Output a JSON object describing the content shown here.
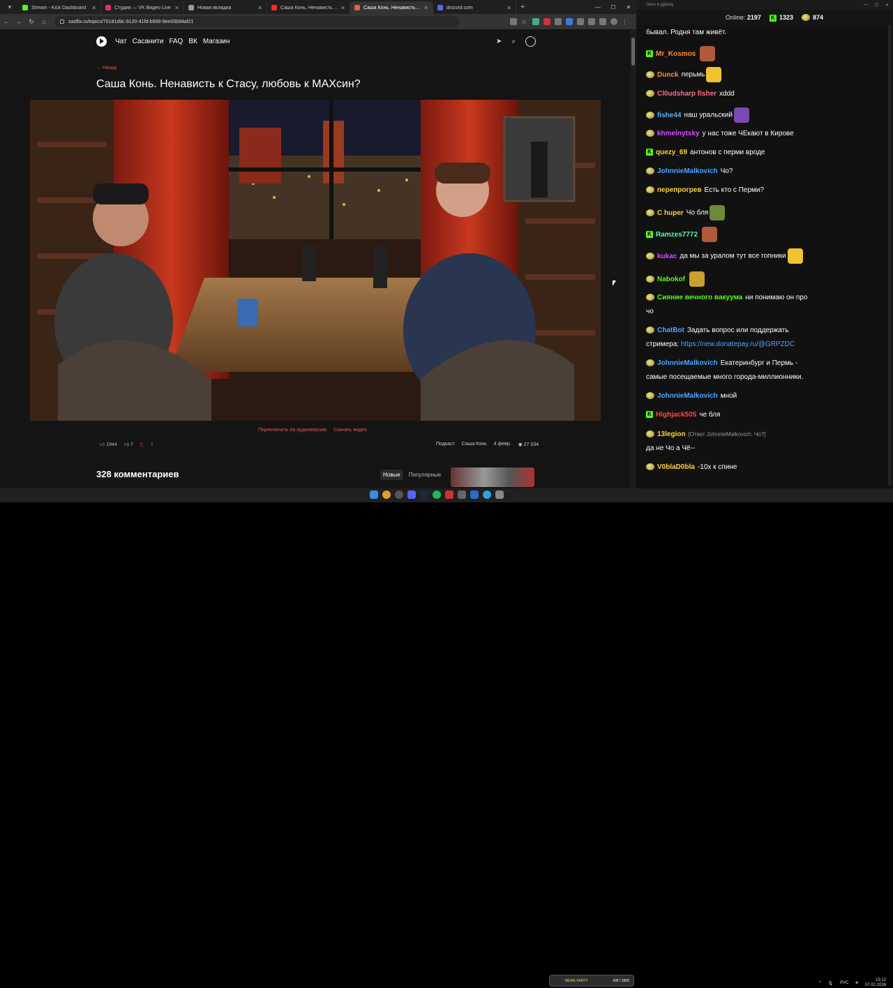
{
  "browser": {
    "tabs": [
      {
        "label": "Stream - Kick Dashboard",
        "color": "#53fc18"
      },
      {
        "label": "Студия — VK Видео Live",
        "color": "#e0306a"
      },
      {
        "label": "Новая вкладка",
        "color": "#999999"
      },
      {
        "label": "Саша Конь. Ненависть к Стасу",
        "color": "#ff2a2a"
      },
      {
        "label": "Саша Конь. Ненависть к С...",
        "color": "#e0604a",
        "active": true
      },
      {
        "label": "discord.com",
        "color": "#5865f2"
      }
    ],
    "url": "sasflix.ru/topics/75181d9c-9120-41fd-b999-9ee00b94af21"
  },
  "site": {
    "nav": [
      "Чат",
      "Сасанити",
      "FAQ",
      "ВК",
      "Магазин"
    ],
    "back": "← Назад",
    "title": "Саша Конь. Ненависть к Стасу, любовь к МАХсин?",
    "audio_link": "Переключить на аудиоверсию",
    "download_link": "Скачать видео",
    "likes": "1944",
    "dislikes": "7",
    "category": "Подкаст",
    "author": "Саша Конь",
    "date": "4 февр.",
    "views": "27 034",
    "comments_title": "328 комментариев",
    "sort_new": "Новые",
    "sort_popular": "Популярные"
  },
  "chat": {
    "window_title": "Окно в дураку",
    "online_label": "Online:",
    "online": "2197",
    "kick_count": "1323",
    "other_count": "874",
    "messages": [
      {
        "user": "",
        "text": "бывал. Родня там живёт.",
        "color": "#ffffff"
      },
      {
        "user": "Mr_Kosmos",
        "text": "",
        "color": "#ff8a3a",
        "badge": "kick",
        "emote": "#b05a3a"
      },
      {
        "user": "Dunck",
        "text": "перьмь",
        "color": "#ff8a3a",
        "badge": "pepe",
        "emote": "#f2c230"
      },
      {
        "user": "Cl0udsharp fisher",
        "text": "xddd",
        "color": "#ff6b8a",
        "badge": "pepe"
      },
      {
        "user": "fishe44",
        "text": "наш уральский",
        "color": "#5db0ff",
        "badge": "pepe",
        "emote": "#7a4ab0"
      },
      {
        "user": "khmelnytsky",
        "text": "у нас тоже ЧЕкают в Кирове",
        "color": "#d24dff",
        "badge": "pepe"
      },
      {
        "user": "quezy_69",
        "text": "антонов с перми вроде",
        "color": "#ffd23a",
        "badge": "kick"
      },
      {
        "user": "JohnnieMalkovich",
        "text": "Чо?",
        "color": "#4ea4ff",
        "badge": "pepe"
      },
      {
        "user": "перепрогрев",
        "text": "Есть кто с Перми?",
        "color": "#ffd23a",
        "badge": "pepe"
      },
      {
        "user": "C huper",
        "text": "Чо бля",
        "color": "#ffd23a",
        "badge": "pepe",
        "emote": "#6b8a3a"
      },
      {
        "user": "Ramzes7772",
        "text": "",
        "color": "#53fcb0",
        "badge": "kick",
        "emote": "#b05a3a"
      },
      {
        "user": "kukac",
        "text": "да мы за уралом тут все гопники",
        "color": "#d24dff",
        "badge": "pepe",
        "emote": "#f2c230"
      },
      {
        "user": "Nabokof",
        "text": "",
        "color": "#53fc18",
        "badge": "pepe",
        "emote": "#c8a030"
      },
      {
        "user": "Сияние вечного вакуума",
        "text": "ни понимаю он про",
        "color": "#53fc18",
        "badge": "pepe"
      },
      {
        "user": "",
        "text": "чо",
        "color": "#ffffff"
      },
      {
        "user": "ChatBot",
        "text": "Задать вопрос или поддержать",
        "color": "#4ea4ff",
        "badge": "pepe"
      },
      {
        "user": "",
        "text": "стримера: ",
        "color": "#ffffff",
        "link": "https://new.donatepay.ru/@GRPZDC"
      },
      {
        "user": "JohnnieMalkovich",
        "text": "Екатеринбург и Пермь -",
        "color": "#4ea4ff",
        "badge": "pepe"
      },
      {
        "user": "",
        "text": "самые посещаемые много города-миллионники.",
        "color": "#ffffff"
      },
      {
        "user": "JohnnieMalkovich",
        "text": "мной",
        "color": "#4ea4ff",
        "badge": "pepe"
      },
      {
        "user": "Highjack505",
        "text": "че бля",
        "color": "#ff4a4a",
        "badge": "kick"
      },
      {
        "user": "13legion",
        "text": "",
        "color": "#ffd23a",
        "badge": "pepe",
        "reply": "[Ответ JohnnieMalkovich: Чо?]"
      },
      {
        "user": "",
        "text": "да не  Чо   а  Чё--",
        "color": "#ffffff"
      },
      {
        "user": "V0blaD0bla",
        "text": "-10x к спине",
        "color": "#ffd23a",
        "badge": "pepe"
      }
    ]
  },
  "taskbar": {
    "meme_label": "MEME PARTY",
    "meme_value": "435 / 1500",
    "lang": "РУС",
    "time": "15:12",
    "date": "07.02.2026"
  }
}
